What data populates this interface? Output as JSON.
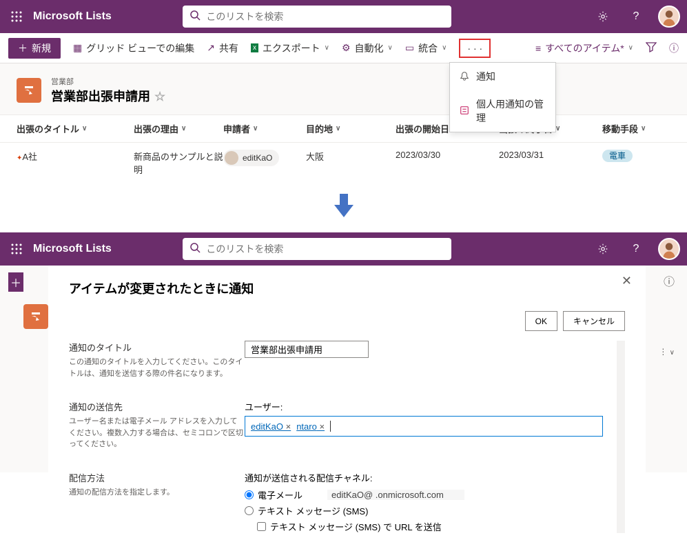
{
  "app": {
    "title": "Microsoft Lists"
  },
  "search": {
    "placeholder": "このリストを検索"
  },
  "cmdbar": {
    "new": "新規",
    "gridEdit": "グリッド ビューでの編集",
    "share": "共有",
    "export": "エクスポート",
    "automate": "自動化",
    "integrate": "統合",
    "viewAll": "すべてのアイテム*"
  },
  "menu": {
    "notify": "通知",
    "manage": "個人用通知の管理"
  },
  "list": {
    "dept": "営業部",
    "name": "営業部出張申請用"
  },
  "columns": {
    "title": "出張のタイトル",
    "reason": "出張の理由",
    "applicant": "申請者",
    "dest": "目的地",
    "start": "出張の開始日",
    "end": "出張の終了日",
    "transport": "移動手段"
  },
  "rows": [
    {
      "title": "A社",
      "reason": "新商品のサンプルと説明",
      "applicant": "editKaO",
      "dest": "大阪",
      "start": "2023/03/30",
      "end": "2023/03/31",
      "transport": "電車"
    }
  ],
  "dialog": {
    "heading": "アイテムが変更されたときに通知",
    "ok": "OK",
    "cancel": "キャンセル",
    "titleLabel": "通知のタイトル",
    "titleDesc": "この通知のタイトルを入力してください。このタイトルは、通知を送信する際の件名になります。",
    "titleValue": "営業部出張申請用",
    "sendToLabel": "通知の送信先",
    "sendToDesc": "ユーザー名または電子メール アドレスを入力してください。複数入力する場合は、セミコロンで区切ってください。",
    "usersLabel": "ユーザー:",
    "users": [
      "editKaO",
      "ntaro"
    ],
    "deliveryLabel": "配信方法",
    "deliveryDesc": "通知の配信方法を指定します。",
    "channelLabel": "通知が送信される配信チャネル:",
    "email": "電子メール",
    "emailValue": "editKaO@                    .onmicrosoft.com",
    "sms": "テキスト メッセージ (SMS)",
    "smsUrl": "テキスト メッセージ (SMS) で URL を送信"
  }
}
